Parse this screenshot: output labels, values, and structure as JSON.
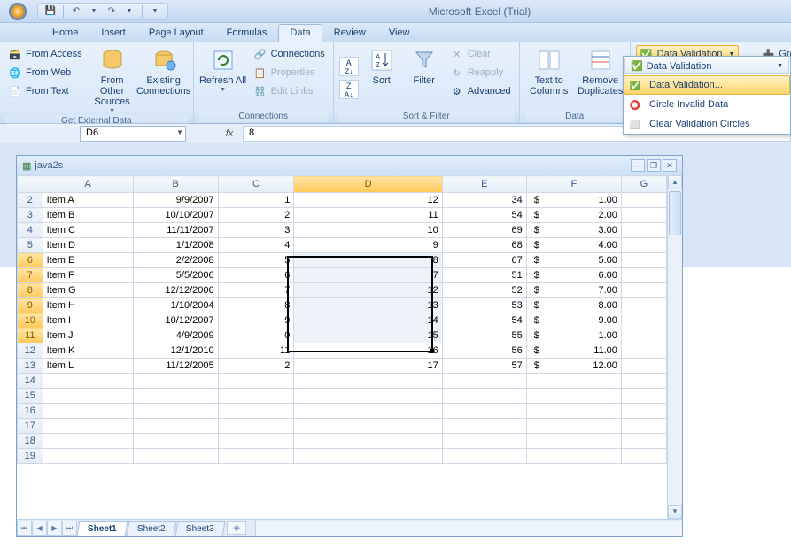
{
  "app_title": "Microsoft Excel (Trial)",
  "qat": {
    "save": "💾",
    "undo": "↶",
    "redo": "↷"
  },
  "tabs": [
    "Home",
    "Insert",
    "Page Layout",
    "Formulas",
    "Data",
    "Review",
    "View"
  ],
  "active_tab": "Data",
  "ribbon": {
    "external": {
      "label": "Get External Data",
      "access": "From Access",
      "web": "From Web",
      "text": "From Text",
      "other": "From Other Sources",
      "existing": "Existing Connections"
    },
    "connections": {
      "label": "Connections",
      "refresh": "Refresh All",
      "conn": "Connections",
      "props": "Properties",
      "links": "Edit Links"
    },
    "sortfilter": {
      "label": "Sort & Filter",
      "sort": "Sort",
      "filter": "Filter",
      "clear": "Clear",
      "reapply": "Reapply",
      "advanced": "Advanced"
    },
    "datatools_label": "Data",
    "texttocol": "Text to Columns",
    "removedup": "Remove Duplicates",
    "validation_btn": "Data Validation",
    "group": "Group"
  },
  "dropdown": {
    "head": "Data Validation",
    "items": [
      "Data Validation...",
      "Circle Invalid Data",
      "Clear Validation Circles"
    ]
  },
  "namebox": "D6",
  "formula_value": "8",
  "workbook_title": "java2s",
  "columns": [
    "A",
    "B",
    "C",
    "D",
    "E",
    "F",
    "G"
  ],
  "active_col": "D",
  "rows": [
    {
      "n": 2,
      "a": "Item A",
      "b": "9/9/2007",
      "c": "1",
      "d": "12",
      "e": "34",
      "f": "1.00"
    },
    {
      "n": 3,
      "a": "Item B",
      "b": "10/10/2007",
      "c": "2",
      "d": "11",
      "e": "54",
      "f": "2.00"
    },
    {
      "n": 4,
      "a": "Item C",
      "b": "11/11/2007",
      "c": "3",
      "d": "10",
      "e": "69",
      "f": "3.00"
    },
    {
      "n": 5,
      "a": "Item D",
      "b": "1/1/2008",
      "c": "4",
      "d": "9",
      "e": "68",
      "f": "4.00"
    },
    {
      "n": 6,
      "a": "Item E",
      "b": "2/2/2008",
      "c": "5",
      "d": "8",
      "e": "67",
      "f": "5.00"
    },
    {
      "n": 7,
      "a": "Item F",
      "b": "5/5/2006",
      "c": "6",
      "d": "7",
      "e": "51",
      "f": "6.00"
    },
    {
      "n": 8,
      "a": "Item G",
      "b": "12/12/2006",
      "c": "7",
      "d": "12",
      "e": "52",
      "f": "7.00"
    },
    {
      "n": 9,
      "a": "Item H",
      "b": "1/10/2004",
      "c": "8",
      "d": "13",
      "e": "53",
      "f": "8.00"
    },
    {
      "n": 10,
      "a": "Item I",
      "b": "10/12/2007",
      "c": "9",
      "d": "14",
      "e": "54",
      "f": "9.00"
    },
    {
      "n": 11,
      "a": "Item J",
      "b": "4/9/2009",
      "c": "0",
      "d": "15",
      "e": "55",
      "f": "1.00"
    },
    {
      "n": 12,
      "a": "Item K",
      "b": "12/1/2010",
      "c": "11",
      "d": "16",
      "e": "56",
      "f": "11.00"
    },
    {
      "n": 13,
      "a": "Item L",
      "b": "11/12/2005",
      "c": "2",
      "d": "17",
      "e": "57",
      "f": "12.00"
    }
  ],
  "empty_rows": [
    14,
    15,
    16,
    17,
    18,
    19
  ],
  "selection": {
    "top_row": 6,
    "bottom_row": 11,
    "col": "D"
  },
  "sheets": [
    "Sheet1",
    "Sheet2",
    "Sheet3"
  ],
  "active_sheet": "Sheet1"
}
